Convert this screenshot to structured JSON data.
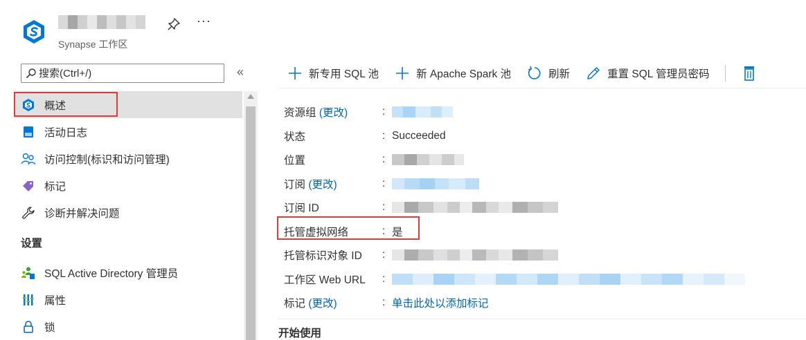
{
  "header": {
    "resource_name": "",
    "resource_type": "Synapse 工作区",
    "pin_icon": "pin-icon",
    "more_label": "···"
  },
  "search": {
    "placeholder": "搜索(Ctrl+/)",
    "collapse_label": "«"
  },
  "nav": {
    "items": [
      {
        "label": "概述",
        "icon": "synapse-workspace-icon",
        "selected": true
      },
      {
        "label": "活动日志",
        "icon": "activity-log-icon"
      },
      {
        "label": "访问控制(标识和访问管理)",
        "icon": "access-control-icon"
      },
      {
        "label": "标记",
        "icon": "tag-icon"
      },
      {
        "label": "诊断并解决问题",
        "icon": "wrench-icon"
      }
    ],
    "section_settings": "设置",
    "settings_items": [
      {
        "label": "SQL Active Directory 管理员",
        "icon": "sql-ad-admin-icon"
      },
      {
        "label": "属性",
        "icon": "properties-icon"
      },
      {
        "label": "锁",
        "icon": "lock-icon"
      }
    ]
  },
  "toolbar": {
    "new_sql_pool": "新专用 SQL 池",
    "new_spark_pool": "新 Apache Spark 池",
    "refresh": "刷新",
    "reset_password": "重置 SQL 管理员密码"
  },
  "properties": {
    "resource_group_label": "资源组",
    "change_link": "(更改)",
    "status_label": "状态",
    "status_value": "Succeeded",
    "location_label": "位置",
    "subscription_label": "订阅",
    "subscription_id_label": "订阅 ID",
    "managed_vnet_label": "托管虚拟网络",
    "managed_vnet_value": "是",
    "managed_identity_label": "托管标识对象 ID",
    "web_url_label": "工作区 Web URL",
    "tags_label": "标记",
    "tags_value": "单击此处以添加标记",
    "colon": ":"
  },
  "sections": {
    "getting_started": "开始使用"
  },
  "colors": {
    "accent_blue": "#0078d4",
    "link_blue": "#0067b8",
    "highlight_red": "#e03a3a",
    "selected_bg": "#e1e1e1"
  }
}
